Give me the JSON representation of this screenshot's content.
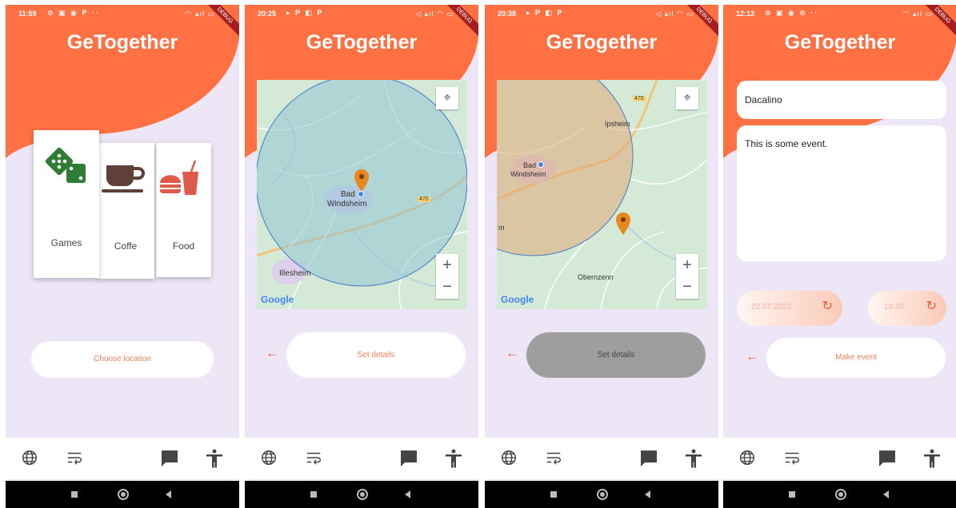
{
  "colors": {
    "accent": "#ff7043",
    "bg": "#ece6f6",
    "link": "#f0805e"
  },
  "screens": [
    {
      "status": {
        "time": "11:59",
        "extra": "⊙ ▣ ◉ P  ··",
        "icons": "◠ ▴ıl ▭"
      },
      "title": "GeTogether",
      "categories": [
        {
          "label": "Games",
          "icon": "dice-icon"
        },
        {
          "label": "Coffe",
          "icon": "coffee-cup-icon"
        },
        {
          "label": "Food",
          "icon": "fast-food-icon"
        }
      ],
      "action_label": "Choose location"
    },
    {
      "status": {
        "time": "20:25",
        "extra": "▸ P ◧ P",
        "icons": "◁ ▴ıl ◠ ▭"
      },
      "title": "GeTogether",
      "map": {
        "labels": [
          "Bad",
          "Windsheim",
          "Illesheim",
          "470"
        ],
        "google": "Google",
        "zoom_in": "+",
        "zoom_out": "−"
      },
      "action_label": "Set details"
    },
    {
      "status": {
        "time": "20:38",
        "extra": "▸ P ◧ P",
        "icons": "◁ ▴ıl ◠ ▭"
      },
      "title": "GeTogether",
      "map": {
        "labels": [
          "Bad",
          "Windsheim",
          "Ipsheim",
          "Obernzenn",
          "m",
          "470"
        ],
        "google": "Google",
        "zoom_in": "+",
        "zoom_out": "−"
      },
      "action_label": "Set details"
    },
    {
      "status": {
        "time": "12:13",
        "extra": "⊙ ▣ ◉ ⊙  ··",
        "icons": "◠ ▴ıl ▭"
      },
      "title": "GeTogether",
      "name_value": "Dacalino",
      "description_value": "This is some event.",
      "date_value": "22.07.2022",
      "time_value": "18:45",
      "action_label": "Make event"
    }
  ],
  "debug_banner": "DEBUG"
}
